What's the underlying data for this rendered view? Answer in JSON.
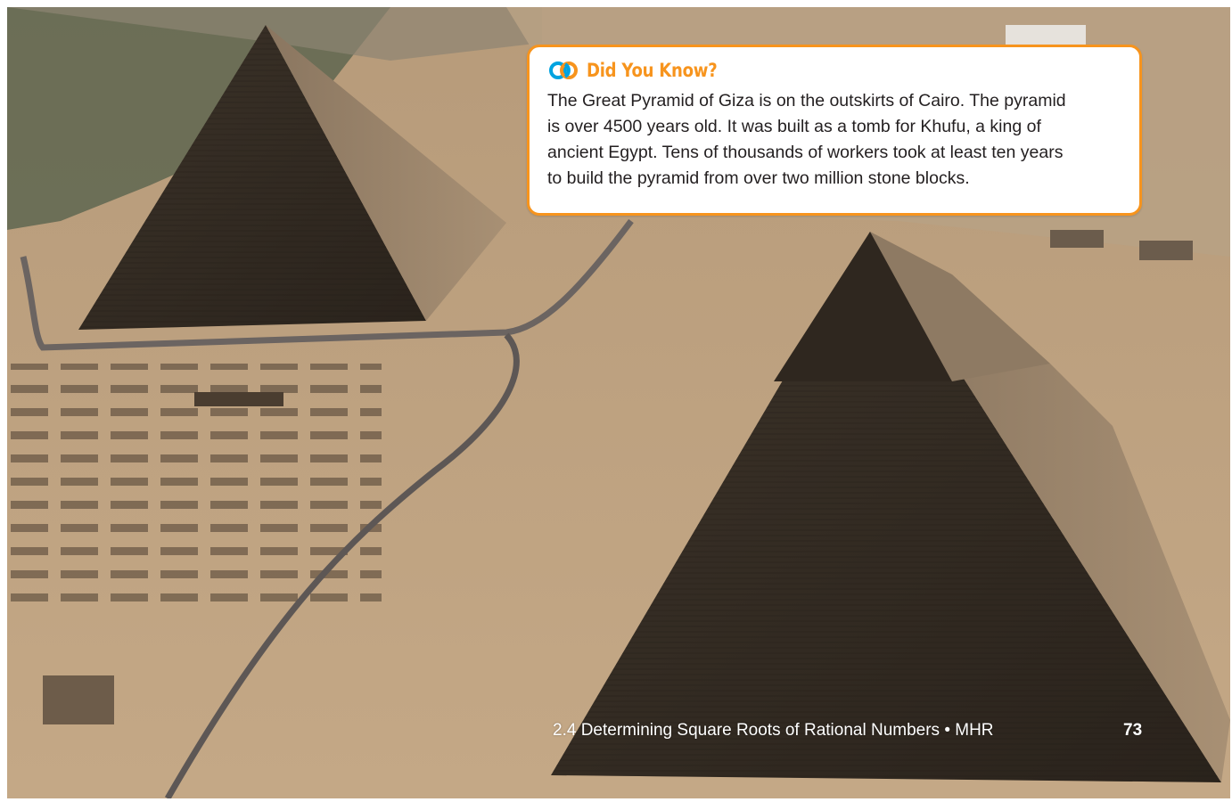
{
  "callout": {
    "icon": "did-you-know-rings-icon",
    "title": "Did You Know?",
    "lines": [
      "The Great Pyramid of Giza is on the outskirts of Cairo. The pyramid",
      "is over 4500 years old. It was built as a tomb for Khufu, a king of",
      "ancient Egypt. Tens of thousands of workers took at least ten years",
      "to build the pyramid from over two million stone blocks."
    ]
  },
  "footer": {
    "section": "2.4 Determining Square Roots of Rational Numbers • MHR",
    "page_number": "73"
  },
  "colors": {
    "accent_orange": "#f7941d",
    "icon_blue": "#00a3e0",
    "text_dark": "#231f20"
  }
}
